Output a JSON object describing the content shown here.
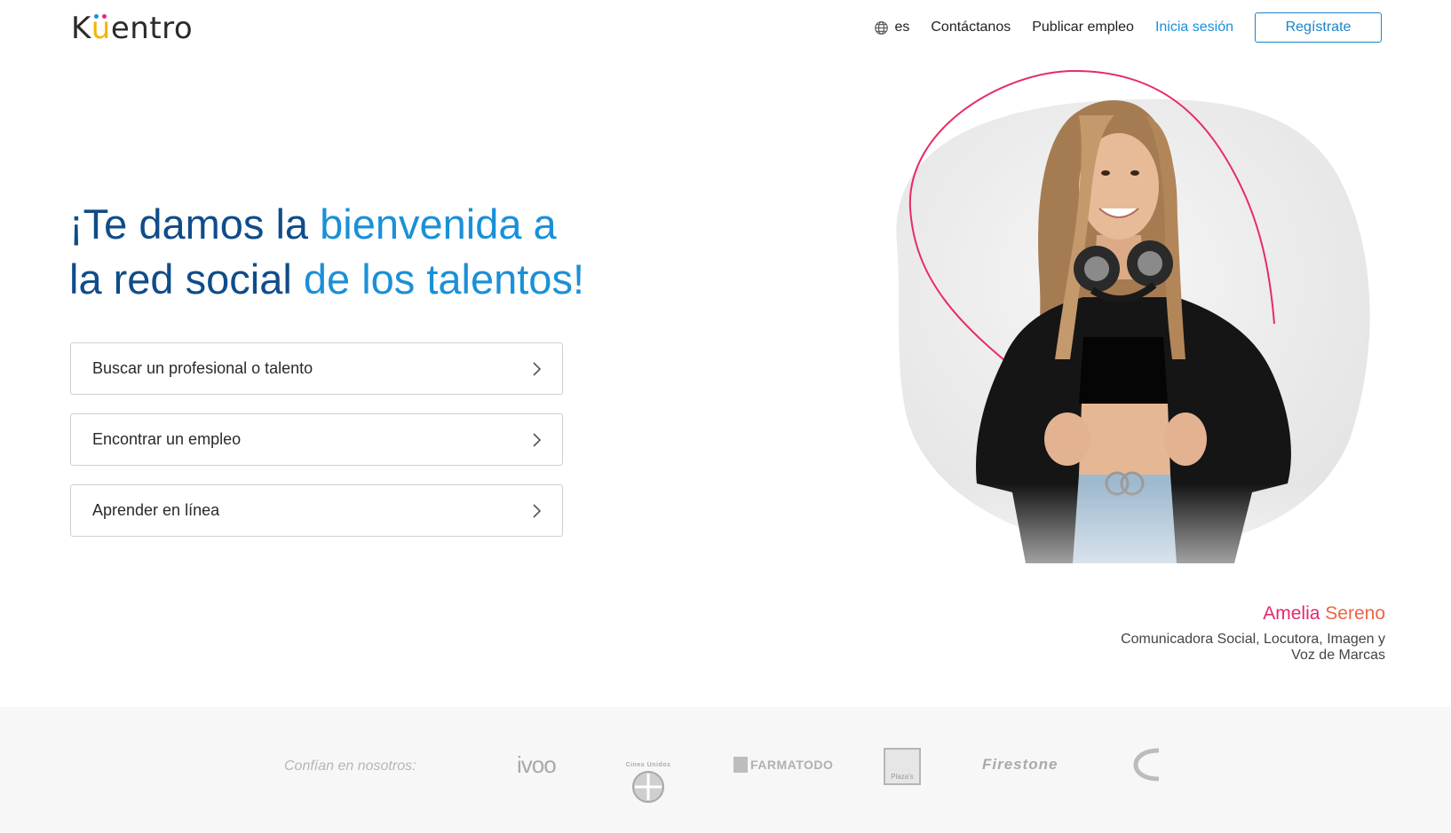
{
  "header": {
    "logo_text": "Kuentro",
    "logo_prefix": "K",
    "logo_u": "u",
    "logo_suffix": "entro",
    "language": "es",
    "nav_contact": "Contáctanos",
    "nav_post_job": "Publicar empleo",
    "nav_login": "Inicia sesión",
    "nav_register": "Regístrate"
  },
  "hero": {
    "title_line1_dark": "¡Te damos la ",
    "title_line1_light": "bienvenida a",
    "title_line2_dark": "la red social ",
    "title_line2_light": "de los talentos!",
    "options": [
      {
        "label": "Buscar un profesional o talento"
      },
      {
        "label": "Encontrar un empleo"
      },
      {
        "label": "Aprender en línea"
      }
    ]
  },
  "featured": {
    "first_name": "Amelia",
    "last_name": "Sereno",
    "role_line1": "Comunicadora Social, Locutora, Imagen y",
    "role_line2": "Voz de Marcas"
  },
  "trust": {
    "label": "Confían en nosotros:",
    "brands": [
      "ivoo",
      "Cines Unidos",
      "Farmatodo",
      "Plaza's",
      "Firestone"
    ]
  },
  "colors": {
    "dark_blue": "#0f4c8a",
    "light_blue": "#1a90d8",
    "pink": "#e5266f",
    "orange": "#f06442"
  }
}
